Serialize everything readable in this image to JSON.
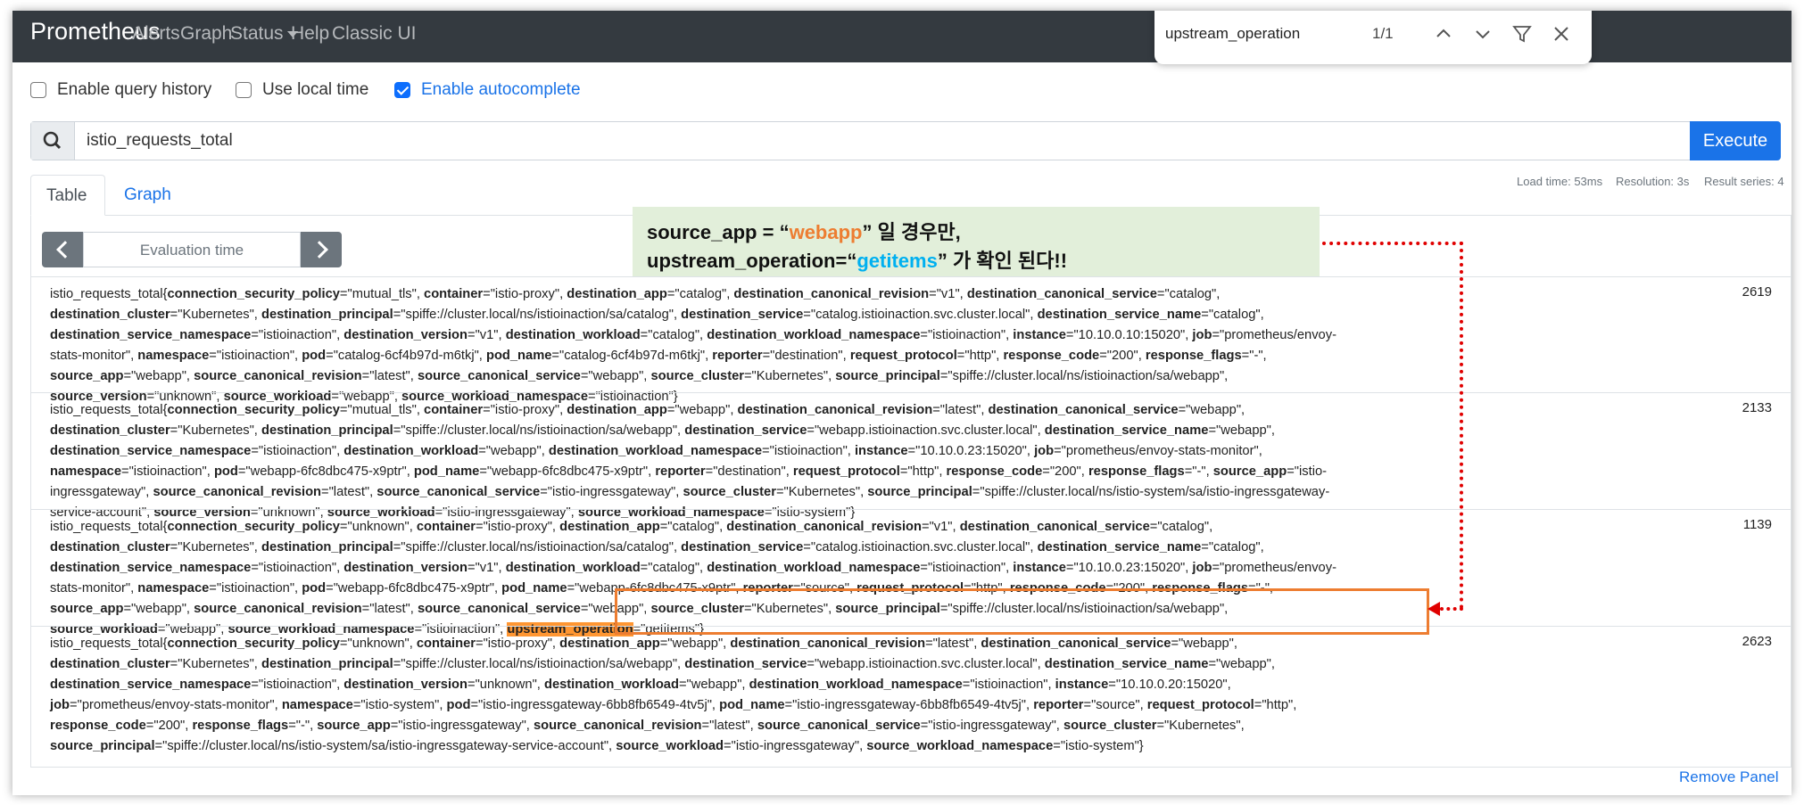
{
  "navbar": {
    "brand": "Prometheus",
    "links": [
      "Alerts",
      "Graph",
      "Status",
      "Help",
      "Classic UI"
    ]
  },
  "findbar": {
    "query": "upstream_operation",
    "count": "1/1"
  },
  "options": [
    {
      "label": "Enable query history",
      "checked": false
    },
    {
      "label": "Use local time",
      "checked": false
    },
    {
      "label": "Enable autocomplete",
      "checked": true
    }
  ],
  "query": {
    "expression": "istio_requests_total",
    "execute_label": "Execute"
  },
  "stats": {
    "load_time": "Load time: 53ms",
    "resolution": "Resolution: 3s",
    "result_series": "Result series: 4"
  },
  "tabs": {
    "table": "Table",
    "graph": "Graph"
  },
  "eval": {
    "placeholder": "Evaluation time"
  },
  "results": [
    {
      "metric": "istio_requests_total",
      "value": "2619",
      "labels": [
        [
          "connection_security_policy",
          "mutual_tls"
        ],
        [
          "container",
          "istio-proxy"
        ],
        [
          "destination_app",
          "catalog"
        ],
        [
          "destination_canonical_revision",
          "v1"
        ],
        [
          "destination_canonical_service",
          "catalog"
        ],
        [
          "destination_cluster",
          "Kubernetes"
        ],
        [
          "destination_principal",
          "spiffe://cluster.local/ns/istioinaction/sa/catalog"
        ],
        [
          "destination_service",
          "catalog.istioinaction.svc.cluster.local"
        ],
        [
          "destination_service_name",
          "catalog"
        ],
        [
          "destination_service_namespace",
          "istioinaction"
        ],
        [
          "destination_version",
          "v1"
        ],
        [
          "destination_workload",
          "catalog"
        ],
        [
          "destination_workload_namespace",
          "istioinaction"
        ],
        [
          "instance",
          "10.10.0.10:15020"
        ],
        [
          "job",
          "prometheus/envoy-stats-monitor"
        ],
        [
          "namespace",
          "istioinaction"
        ],
        [
          "pod",
          "catalog-6cf4b97d-m6tkj"
        ],
        [
          "pod_name",
          "catalog-6cf4b97d-m6tkj"
        ],
        [
          "reporter",
          "destination"
        ],
        [
          "request_protocol",
          "http"
        ],
        [
          "response_code",
          "200"
        ],
        [
          "response_flags",
          "-"
        ],
        [
          "source_app",
          "webapp"
        ],
        [
          "source_canonical_revision",
          "latest"
        ],
        [
          "source_canonical_service",
          "webapp"
        ],
        [
          "source_cluster",
          "Kubernetes"
        ],
        [
          "source_principal",
          "spiffe://cluster.local/ns/istioinaction/sa/webapp"
        ],
        [
          "source_version",
          "unknown"
        ],
        [
          "source_workload",
          "webapp"
        ],
        [
          "source_workload_namespace",
          "istioinaction"
        ]
      ]
    },
    {
      "metric": "istio_requests_total",
      "value": "2133",
      "labels": [
        [
          "connection_security_policy",
          "mutual_tls"
        ],
        [
          "container",
          "istio-proxy"
        ],
        [
          "destination_app",
          "webapp"
        ],
        [
          "destination_canonical_revision",
          "latest"
        ],
        [
          "destination_canonical_service",
          "webapp"
        ],
        [
          "destination_cluster",
          "Kubernetes"
        ],
        [
          "destination_principal",
          "spiffe://cluster.local/ns/istioinaction/sa/webapp"
        ],
        [
          "destination_service",
          "webapp.istioinaction.svc.cluster.local"
        ],
        [
          "destination_service_name",
          "webapp"
        ],
        [
          "destination_service_namespace",
          "istioinaction"
        ],
        [
          "destination_workload",
          "webapp"
        ],
        [
          "destination_workload_namespace",
          "istioinaction"
        ],
        [
          "instance",
          "10.10.0.23:15020"
        ],
        [
          "job",
          "prometheus/envoy-stats-monitor"
        ],
        [
          "namespace",
          "istioinaction"
        ],
        [
          "pod",
          "webapp-6fc8dbc475-x9ptr"
        ],
        [
          "pod_name",
          "webapp-6fc8dbc475-x9ptr"
        ],
        [
          "reporter",
          "destination"
        ],
        [
          "request_protocol",
          "http"
        ],
        [
          "response_code",
          "200"
        ],
        [
          "response_flags",
          "-"
        ],
        [
          "source_app",
          "istio-ingressgateway"
        ],
        [
          "source_canonical_revision",
          "latest"
        ],
        [
          "source_canonical_service",
          "istio-ingressgateway"
        ],
        [
          "source_cluster",
          "Kubernetes"
        ],
        [
          "source_principal",
          "spiffe://cluster.local/ns/istio-system/sa/istio-ingressgateway-service-account"
        ],
        [
          "source_version",
          "unknown"
        ],
        [
          "source_workload",
          "istio-ingressgateway"
        ],
        [
          "source_workload_namespace",
          "istio-system"
        ]
      ]
    },
    {
      "metric": "istio_requests_total",
      "value": "1139",
      "labels": [
        [
          "connection_security_policy",
          "unknown"
        ],
        [
          "container",
          "istio-proxy"
        ],
        [
          "destination_app",
          "catalog"
        ],
        [
          "destination_canonical_revision",
          "v1"
        ],
        [
          "destination_canonical_service",
          "catalog"
        ],
        [
          "destination_cluster",
          "Kubernetes"
        ],
        [
          "destination_principal",
          "spiffe://cluster.local/ns/istioinaction/sa/catalog"
        ],
        [
          "destination_service",
          "catalog.istioinaction.svc.cluster.local"
        ],
        [
          "destination_service_name",
          "catalog"
        ],
        [
          "destination_service_namespace",
          "istioinaction"
        ],
        [
          "destination_version",
          "v1"
        ],
        [
          "destination_workload",
          "catalog"
        ],
        [
          "destination_workload_namespace",
          "istioinaction"
        ],
        [
          "instance",
          "10.10.0.23:15020"
        ],
        [
          "job",
          "prometheus/envoy-stats-monitor"
        ],
        [
          "namespace",
          "istioinaction"
        ],
        [
          "pod",
          "webapp-6fc8dbc475-x9ptr"
        ],
        [
          "pod_name",
          "webapp-6fc8dbc475-x9ptr"
        ],
        [
          "reporter",
          "source"
        ],
        [
          "request_protocol",
          "http"
        ],
        [
          "response_code",
          "200"
        ],
        [
          "response_flags",
          "-"
        ],
        [
          "source_app",
          "webapp"
        ],
        [
          "source_canonical_revision",
          "latest"
        ],
        [
          "source_canonical_service",
          "webapp"
        ],
        [
          "source_cluster",
          "Kubernetes"
        ],
        [
          "source_principal",
          "spiffe://cluster.local/ns/istioinaction/sa/webapp"
        ],
        [
          "source_workload",
          "webapp"
        ],
        [
          "source_workload_namespace",
          "istioinaction"
        ],
        [
          "upstream_operation",
          "getitems"
        ]
      ]
    },
    {
      "metric": "istio_requests_total",
      "value": "2623",
      "labels": [
        [
          "connection_security_policy",
          "unknown"
        ],
        [
          "container",
          "istio-proxy"
        ],
        [
          "destination_app",
          "webapp"
        ],
        [
          "destination_canonical_revision",
          "latest"
        ],
        [
          "destination_canonical_service",
          "webapp"
        ],
        [
          "destination_cluster",
          "Kubernetes"
        ],
        [
          "destination_principal",
          "spiffe://cluster.local/ns/istioinaction/sa/webapp"
        ],
        [
          "destination_service",
          "webapp.istioinaction.svc.cluster.local"
        ],
        [
          "destination_service_name",
          "webapp"
        ],
        [
          "destination_service_namespace",
          "istioinaction"
        ],
        [
          "destination_version",
          "unknown"
        ],
        [
          "destination_workload",
          "webapp"
        ],
        [
          "destination_workload_namespace",
          "istioinaction"
        ],
        [
          "instance",
          "10.10.0.20:15020"
        ],
        [
          "job",
          "prometheus/envoy-stats-monitor"
        ],
        [
          "namespace",
          "istio-system"
        ],
        [
          "pod",
          "istio-ingressgateway-6bb8fb6549-4tv5j"
        ],
        [
          "pod_name",
          "istio-ingressgateway-6bb8fb6549-4tv5j"
        ],
        [
          "reporter",
          "source"
        ],
        [
          "request_protocol",
          "http"
        ],
        [
          "response_code",
          "200"
        ],
        [
          "response_flags",
          "-"
        ],
        [
          "source_app",
          "istio-ingressgateway"
        ],
        [
          "source_canonical_revision",
          "latest"
        ],
        [
          "source_canonical_service",
          "istio-ingressgateway"
        ],
        [
          "source_cluster",
          "Kubernetes"
        ],
        [
          "source_principal",
          "spiffe://cluster.local/ns/istio-system/sa/istio-ingressgateway-service-account"
        ],
        [
          "source_workload",
          "istio-ingressgateway"
        ],
        [
          "source_workload_namespace",
          "istio-system"
        ]
      ]
    }
  ],
  "highlight_label": "upstream_operation",
  "annotation": {
    "line1_a": "source_app = “",
    "line1_b": "webapp",
    "line1_c": "” 일 경우만,",
    "line2_a": "upstream_operation=“",
    "line2_b": "getitems",
    "line2_c": "” 가 확인 된다!!"
  },
  "remove_panel": "Remove Panel",
  "colors": {
    "navbar": "#343a40",
    "accent": "#1a73e8",
    "annotation_orange": "#ed7d31",
    "annotation_blue": "#00b0f0",
    "dotted_arrow": "#e00000",
    "search_highlight": "#ff9632"
  }
}
